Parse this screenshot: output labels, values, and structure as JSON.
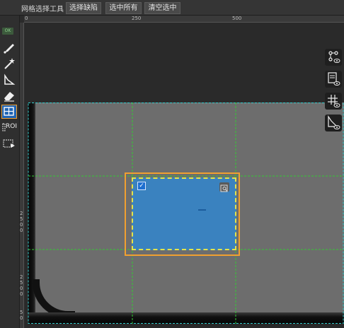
{
  "toolbar": {
    "title": "网格选择工具",
    "btn_select_defect": "选择缺陷",
    "btn_select_all": "选中所有",
    "btn_clear_selection": "清空选中"
  },
  "left_tools": {
    "ok_badge": "OK",
    "roi_label": "ROI"
  },
  "rulers": {
    "top_ticks": [
      "0",
      "250",
      "500"
    ],
    "left_ticks": [
      "2",
      "5",
      "0",
      "0",
      "2",
      "5",
      "0",
      "0",
      "5",
      "0"
    ]
  },
  "selection": {
    "check_mark": "✓"
  },
  "colors": {
    "accent_orange": "#f0a030",
    "selection_fill": "#3a82bf",
    "grid_green": "#33cc33",
    "guide_cyan": "#33cccc"
  },
  "icons": {
    "brush": "brush-icon",
    "magic_wand": "magic-wand-icon",
    "polygon": "polygon-lasso-icon",
    "eraser": "eraser-icon",
    "grid_select": "grid-select-icon",
    "roi": "roi-icon",
    "mask_play": "mask-play-icon",
    "node_view": "node-visibility-icon",
    "list_view": "list-visibility-icon",
    "grid_view": "grid-visibility-icon",
    "measure_view": "measure-visibility-icon"
  }
}
